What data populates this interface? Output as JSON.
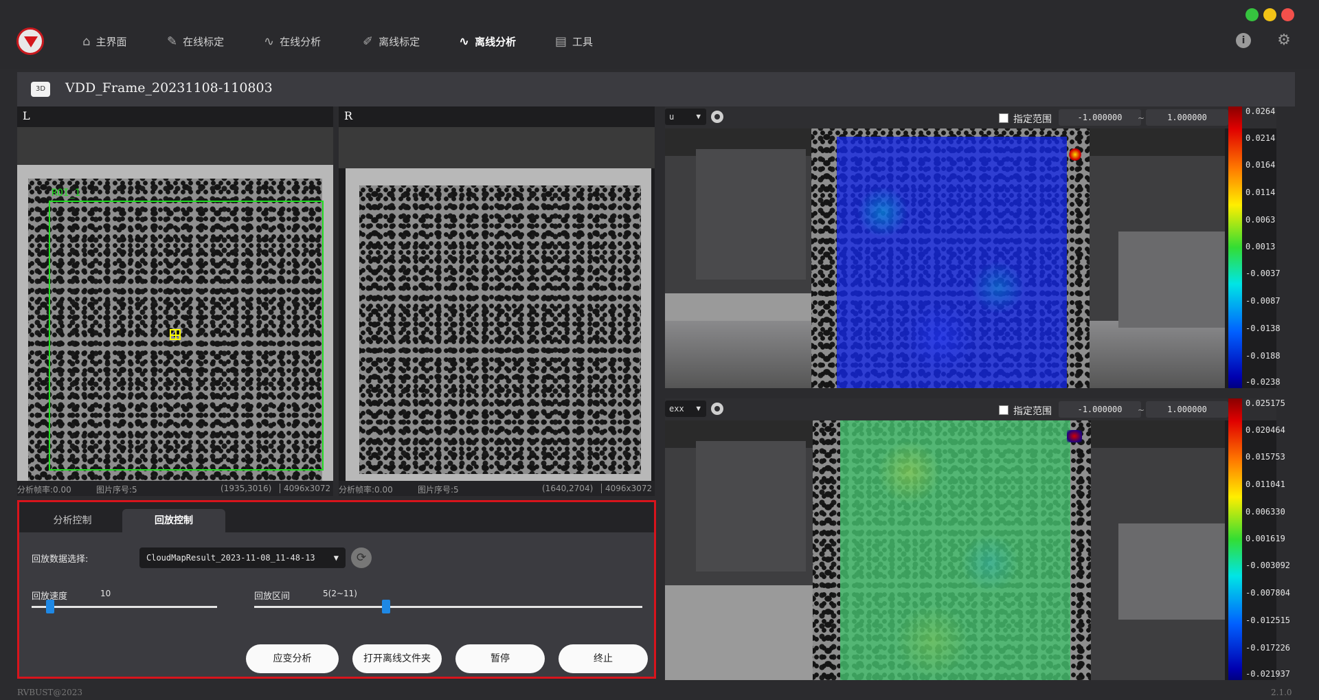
{
  "nav": [
    {
      "icon": "home-icon",
      "label": "主界面"
    },
    {
      "icon": "calibrate-icon",
      "label": "在线标定"
    },
    {
      "icon": "analysis-icon",
      "label": "在线分析"
    },
    {
      "icon": "pen-icon",
      "label": "离线标定"
    },
    {
      "icon": "offline-analysis-icon",
      "label": "离线分析"
    },
    {
      "icon": "toolbox-icon",
      "label": "工具"
    }
  ],
  "active_nav": "离线分析",
  "info_glyph": "i",
  "settings_glyph": "⚙",
  "window_buttons": [
    {
      "name": "minimize",
      "color": "#36c33f"
    },
    {
      "name": "maximize",
      "color": "#f2c316"
    },
    {
      "name": "close",
      "color": "#f2504b"
    }
  ],
  "file": {
    "badge": "3D",
    "name": "VDD_Frame_20231108-110803"
  },
  "cameras": [
    {
      "label": "L",
      "roi_label": "ROI_1",
      "status": {
        "fps": "分析帧率:0.00",
        "index": "图片序号:5",
        "coord": "(1935,3016)",
        "resolution": "4096x3072"
      }
    },
    {
      "label": "R",
      "status": {
        "fps": "分析帧率:0.00",
        "index": "图片序号:5",
        "coord": "(1640,2704)",
        "resolution": "4096x3072"
      }
    }
  ],
  "control": {
    "tabs": [
      "分析控制",
      "回放控制"
    ],
    "active_tab": "回放控制",
    "data_select_label": "回放数据选择:",
    "data_select_value": "CloudMapResult_2023-11-08_11-48-13",
    "speed_label": "回放速度",
    "speed_value": "10",
    "speed_fraction": 0.1,
    "range_label": "回放区间",
    "range_value": "5(2~11)",
    "range_fraction": 0.34,
    "buttons": [
      "应变分析",
      "打开离线文件夹",
      "暂停",
      "终止"
    ]
  },
  "heatmaps": [
    {
      "field": "u",
      "range_label": "指定范围",
      "min": "-1.000000",
      "max": "1.000000",
      "tilde": "~",
      "ticks": [
        "0.0264",
        "0.0214",
        "0.0164",
        "0.0114",
        "0.0063",
        "0.0013",
        "-0.0037",
        "-0.0087",
        "-0.0138",
        "-0.0188",
        "-0.0238"
      ]
    },
    {
      "field": "exx",
      "range_label": "指定范围",
      "min": "-1.000000",
      "max": "1.000000",
      "tilde": "~",
      "ticks": [
        "0.025175",
        "0.020464",
        "0.015753",
        "0.011041",
        "0.006330",
        "0.001619",
        "-0.003092",
        "-0.007804",
        "-0.012515",
        "-0.017226",
        "-0.021937"
      ]
    }
  ],
  "footer": {
    "copyright": "RVBUST@2023",
    "version": "2.1.0"
  }
}
